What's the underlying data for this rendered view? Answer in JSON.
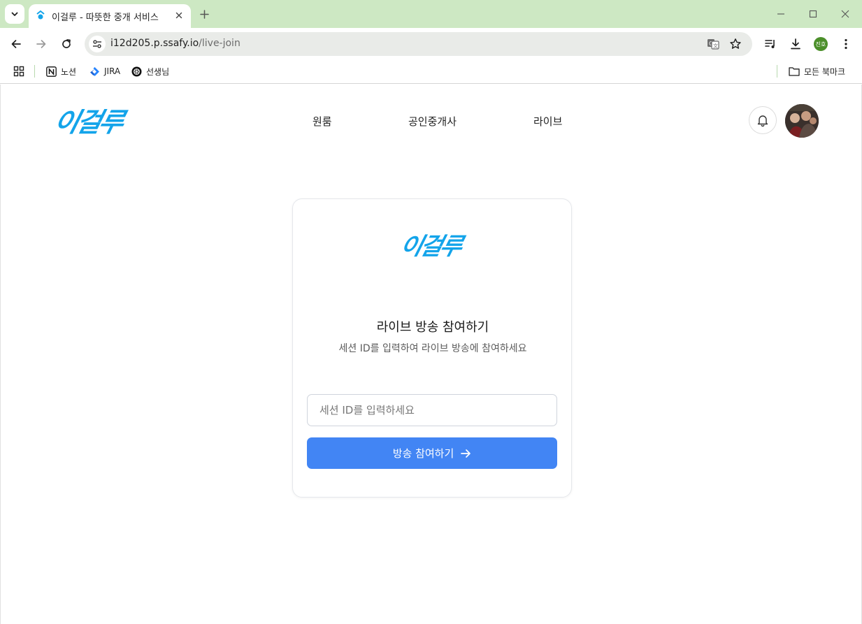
{
  "browser": {
    "tab": {
      "title": "이걸루 - 따뜻한 중개 서비스"
    },
    "address": {
      "host": "i12d205.p.ssafy.io",
      "path": "/live-join"
    },
    "profile_initials": "진호",
    "bookmarks": [
      {
        "label": "노션",
        "icon": "notion-icon"
      },
      {
        "label": "JIRA",
        "icon": "jira-icon"
      },
      {
        "label": "선생님",
        "icon": "openai-icon"
      }
    ],
    "all_bookmarks_label": "모든 북마크"
  },
  "site": {
    "logo_text": "이걸루",
    "nav": [
      "원룸",
      "공인중개사",
      "라이브"
    ]
  },
  "join_card": {
    "title": "라이브 방송 참여하기",
    "subtitle": "세션 ID를 입력하여 라이브 방송에 참여하세요",
    "input_placeholder": "세션 ID를 입력하세요",
    "input_value": "",
    "button_label": "방송 참여하기"
  },
  "colors": {
    "tabbar": "#cde8c3",
    "brand_logo": "#13a4ea",
    "primary_button": "#4285f4"
  }
}
